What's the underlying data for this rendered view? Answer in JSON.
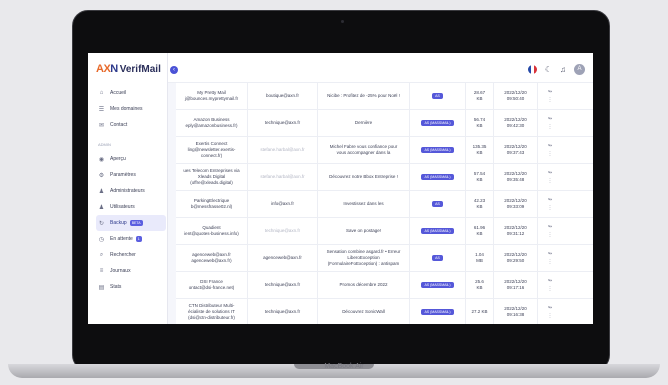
{
  "app": {
    "logo_prefix": "AX",
    "logo_accent": "N",
    "name": "VerifMail",
    "collapse_icon": "chevron-left-icon",
    "device_label": "MacBook Air"
  },
  "sidebar": {
    "items_top": [
      {
        "label": "Accueil",
        "icon": "home-icon",
        "glyph": "⌂"
      },
      {
        "label": "Mes domaines",
        "icon": "list-icon",
        "glyph": "☰"
      },
      {
        "label": "Contact",
        "icon": "mail-icon",
        "glyph": "✉"
      }
    ],
    "section_label": "ADMIN",
    "items_admin": [
      {
        "label": "Aperçu",
        "icon": "eye-icon",
        "glyph": "◉",
        "badge": ""
      },
      {
        "label": "Paramètres",
        "icon": "gear-icon",
        "glyph": "⚙",
        "badge": ""
      },
      {
        "label": "Administrateurs",
        "icon": "user-icon",
        "glyph": "♟",
        "badge": ""
      },
      {
        "label": "Utilisateurs",
        "icon": "users-icon",
        "glyph": "♟",
        "badge": ""
      },
      {
        "label": "Backup",
        "icon": "backup-icon",
        "glyph": "↻",
        "badge": "BETA",
        "active": true
      },
      {
        "label": "En attente",
        "icon": "clock-icon",
        "glyph": "◷",
        "badge": "1"
      },
      {
        "label": "Rechercher",
        "icon": "search-icon",
        "glyph": "⌕",
        "badge": ""
      },
      {
        "label": "Journaux",
        "icon": "log-icon",
        "glyph": "≡",
        "badge": ""
      },
      {
        "label": "Stats",
        "icon": "chart-icon",
        "glyph": "▤",
        "badge": ""
      }
    ]
  },
  "topbar": {
    "flag_icon": "france-flag-icon",
    "theme_icon": "moon-icon",
    "bell_icon": "bell-icon",
    "avatar_letter": "A"
  },
  "table": {
    "rows": [
      {
        "sender": "My Pretty Mail\nj@bounces.myprettymail.fr",
        "from": "boutique@axn.fr",
        "subject": "Nicibe : Profitez de -25% pour Noël !",
        "tag": "AS",
        "size": "28.67\nKB",
        "date": "2022/12/20\n09:50:40"
      },
      {
        "sender": "Amazon Business\neply@amazonbusiness.fr)",
        "from": "technique@axn.fr",
        "subject": "Dernière",
        "tag": "AS (MASSMAIL)",
        "size": "56.74\nKB",
        "date": "2022/12/20\n09:42:30"
      },
      {
        "sender": "Exertis Connect\nling@newsletter.exertis-\nconnect.fr)",
        "from": "stefane.harbal@axn.fr",
        "subject": "Michel Fabre vous confiance pour\nvous accompagner dans la",
        "tag": "AS (MASSMAIL)",
        "size": "135.35\nKB",
        "date": "2022/12/20\n09:37:43",
        "from_muted": true
      },
      {
        "sender": "ues Telecom Entreprises via\nXleads Digital\n(offre@xleads.digital)",
        "from": "stefane.harbal@axn.fr",
        "subject": "Découvrez notre Bbox Entreprise !",
        "tag": "AS (MASSMAIL)",
        "size": "57.54\nKB",
        "date": "2022/12/20\n09:35:48",
        "from_muted": true
      },
      {
        "sender": "ParkingElectrique\nb@messfrasse02.nl)",
        "from": "info@axn.fr",
        "subject": "Investissez dans les",
        "tag": "AS",
        "size": "42.23\nKB",
        "date": "2022/12/20\n09:33:09"
      },
      {
        "sender": "Quadient\nient@quotes-business.info)",
        "from": "technique@axn.fr",
        "subject": "Save on postage!",
        "tag": "AS (MASSMAIL)",
        "size": "61.96\nKB",
        "date": "2022/12/20\n09:31:12",
        "from_muted": true
      },
      {
        "sender": "agenceweb@axn.fr\nagenceweb@axn.fr)",
        "from": "agenceweb@axn.fr",
        "subject": "Sensation combine asgard.fr • Erreur\nLiberoException\n(FormulaireFoException) : antispam",
        "tag": "AS",
        "size": "1.04\nMB",
        "date": "2022/12/20\n09:29:50"
      },
      {
        "sender": "DSI France\nontact@dsi-france.net)",
        "from": "technique@axn.fr",
        "subject": "Promos décembre 2022",
        "tag": "AS (MASSMAIL)",
        "size": "25.6\nKB",
        "date": "2022/12/20\n09:17:16"
      },
      {
        "sender": "CTN Distributeur Multi-\nécialiste de solutions IT\n(dsi@ctn-distributeur.fr)",
        "from": "technique@axn.fr",
        "subject": "Découvrez SonicWall",
        "tag": "AS (MASSMAIL)",
        "size": "27.2 KB",
        "date": "2022/12/20\n09:16:38"
      }
    ],
    "row_actions": {
      "view": "↬",
      "more": "⋮",
      "view_icon": "preview-icon",
      "more_icon": "more-icon"
    }
  }
}
